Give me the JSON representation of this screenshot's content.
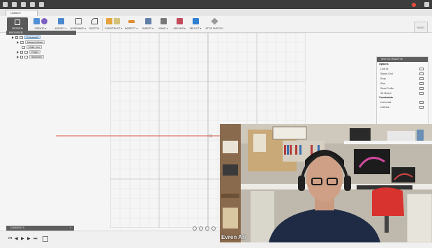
{
  "appbar": {
    "title": "",
    "user": "",
    "status_color": "#e64b3c"
  },
  "document_tab": {
    "label": "Untitled*"
  },
  "toolbar": {
    "workspace": "DESIGN",
    "groups": [
      {
        "label": "CREATE ▾"
      },
      {
        "label": "MODIFY ▾"
      },
      {
        "label": "ASSEMBLE ▾"
      },
      {
        "label": "SKETCH"
      },
      {
        "label": "CONSTRUCT ▾"
      },
      {
        "label": "INSPECT ▾"
      },
      {
        "label": "INSERT ▾"
      },
      {
        "label": "MAKE ▾"
      },
      {
        "label": "ADD-INS ▾"
      },
      {
        "label": "SELECT ▾"
      },
      {
        "label": "STOP SKETCH"
      }
    ],
    "view_cube": "RIGHT"
  },
  "browser": {
    "header": "BROWSER",
    "items": [
      {
        "label": "(Unsaved)"
      },
      {
        "label": "Named Views"
      },
      {
        "label": "Units: mm"
      },
      {
        "label": "Origin"
      },
      {
        "label": "Sketches"
      }
    ]
  },
  "sketch_palette": {
    "header": "SKETCH PALETTE",
    "options_title": "Options",
    "options": [
      {
        "label": "Look At"
      },
      {
        "label": "Sketch Grid"
      },
      {
        "label": "Snap"
      },
      {
        "label": "Slice"
      },
      {
        "label": "Show Profile"
      },
      {
        "label": "3D Sketch"
      }
    ],
    "constraints_title": "Constraints",
    "constraints": [
      {
        "label": "Horizontal"
      },
      {
        "label": "Collinear"
      }
    ]
  },
  "comments": {
    "label": "COMMENTS",
    "add": "+"
  },
  "webcam": {
    "name": "Evren Ari"
  },
  "colors": {
    "accent_blue": "#2f7fd1",
    "axis_red": "#d9553f",
    "grid_line": "#dadada"
  }
}
